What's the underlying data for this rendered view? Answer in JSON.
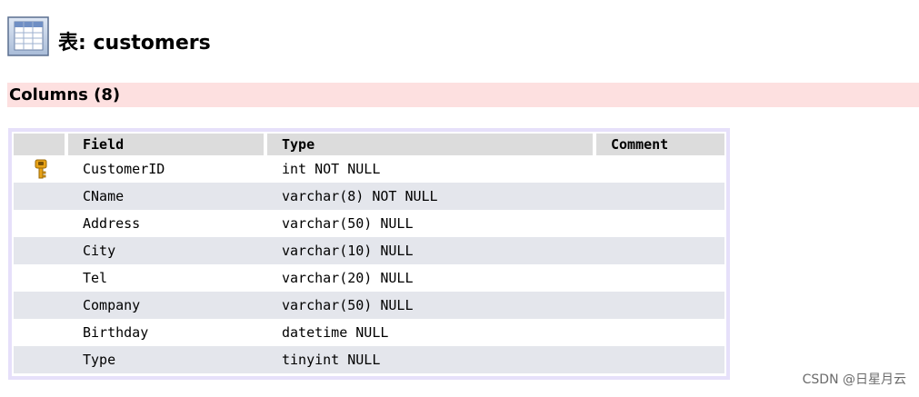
{
  "header": {
    "title_prefix": "表",
    "title_sep": ": ",
    "table_name": "customers",
    "icon": "table-icon"
  },
  "section": {
    "title": "Columns (8)"
  },
  "columns_table": {
    "headers": [
      "Field",
      "Type",
      "Comment"
    ],
    "rows": [
      {
        "field": "CustomerID",
        "type": "int NOT NULL",
        "comment": "",
        "primary_key": true
      },
      {
        "field": "CName",
        "type": "varchar(8) NOT NULL",
        "comment": "",
        "primary_key": false
      },
      {
        "field": "Address",
        "type": "varchar(50) NULL",
        "comment": "",
        "primary_key": false
      },
      {
        "field": "City",
        "type": "varchar(10) NULL",
        "comment": "",
        "primary_key": false
      },
      {
        "field": "Tel",
        "type": "varchar(20) NULL",
        "comment": "",
        "primary_key": false
      },
      {
        "field": "Company",
        "type": "varchar(50) NULL",
        "comment": "",
        "primary_key": false
      },
      {
        "field": "Birthday",
        "type": "datetime NULL",
        "comment": "",
        "primary_key": false
      },
      {
        "field": "Type",
        "type": "tinyint NULL",
        "comment": "",
        "primary_key": false
      }
    ],
    "key_icon": "key-icon"
  },
  "watermark": "CSDN @日星月云",
  "colors": {
    "section_bar": "#fde0e0",
    "header_row": "#dcdcdc",
    "alt_row": "#e4e6ec",
    "table_border": "#e6e0fa",
    "key_icon": "#e8a317"
  }
}
